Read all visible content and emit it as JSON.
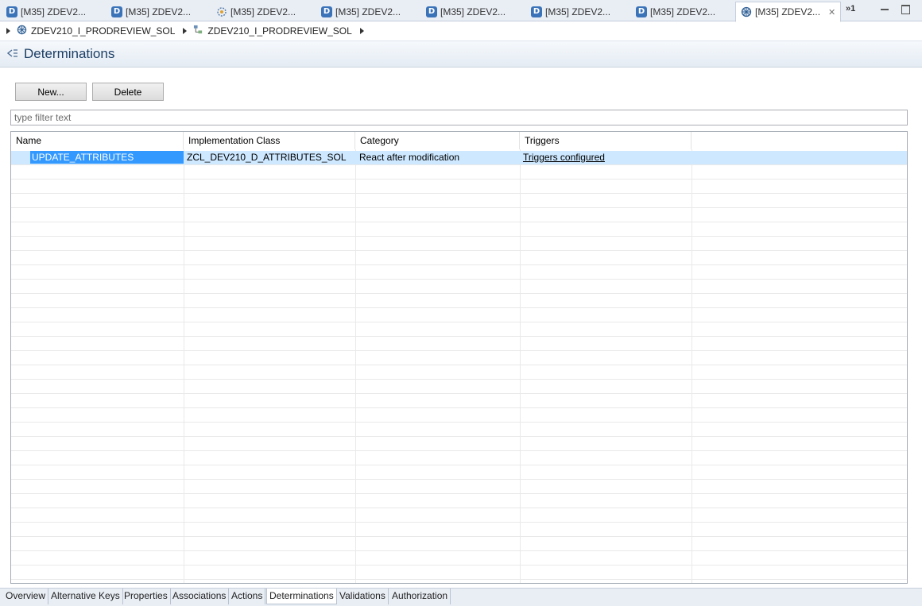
{
  "editor_tabs": [
    {
      "label": "[M35] ZDEV2...",
      "icon": "ddic-icon",
      "active": false
    },
    {
      "label": "[M35] ZDEV2...",
      "icon": "ddic-icon",
      "active": false
    },
    {
      "label": "[M35] ZDEV2...",
      "icon": "behavior-icon",
      "active": false
    },
    {
      "label": "[M35] ZDEV2...",
      "icon": "ddic-icon",
      "active": false
    },
    {
      "label": "[M35] ZDEV2...",
      "icon": "ddic-icon",
      "active": false
    },
    {
      "label": "[M35] ZDEV2...",
      "icon": "ddic-icon",
      "active": false
    },
    {
      "label": "[M35] ZDEV2...",
      "icon": "ddic-icon",
      "active": false
    },
    {
      "label": "[M35] ZDEV2...",
      "icon": "bo-icon",
      "active": true
    }
  ],
  "tab_overflow": "»1",
  "breadcrumb": {
    "items": [
      {
        "label": "ZDEV210_I_PRODREVIEW_SOL"
      },
      {
        "label": "ZDEV210_I_PRODREVIEW_SOL"
      }
    ]
  },
  "section": {
    "title": "Determinations"
  },
  "buttons": {
    "new_label": "New...",
    "delete_label": "Delete"
  },
  "filter": {
    "placeholder": "type filter text"
  },
  "table": {
    "columns": [
      "Name",
      "Implementation Class",
      "Category",
      "Triggers"
    ],
    "rows": [
      {
        "name": "UPDATE_ATTRIBUTES",
        "implementation_class": "ZCL_DEV210_D_ATTRIBUTES_SOL",
        "category": "React after modification",
        "triggers": "Triggers configured"
      }
    ]
  },
  "bottom_tabs": [
    {
      "label": "Overview",
      "active": false
    },
    {
      "label": "Alternative Keys",
      "active": false
    },
    {
      "label": "Properties",
      "active": false
    },
    {
      "label": "Associations",
      "active": false
    },
    {
      "label": "Actions",
      "active": false
    },
    {
      "label": "Determinations",
      "active": true
    },
    {
      "label": "Validations",
      "active": false
    },
    {
      "label": "Authorization",
      "active": false
    }
  ],
  "colors": {
    "selection": "#cde8ff",
    "selected_cell": "#3399ff",
    "header_title": "#1d3f66"
  }
}
